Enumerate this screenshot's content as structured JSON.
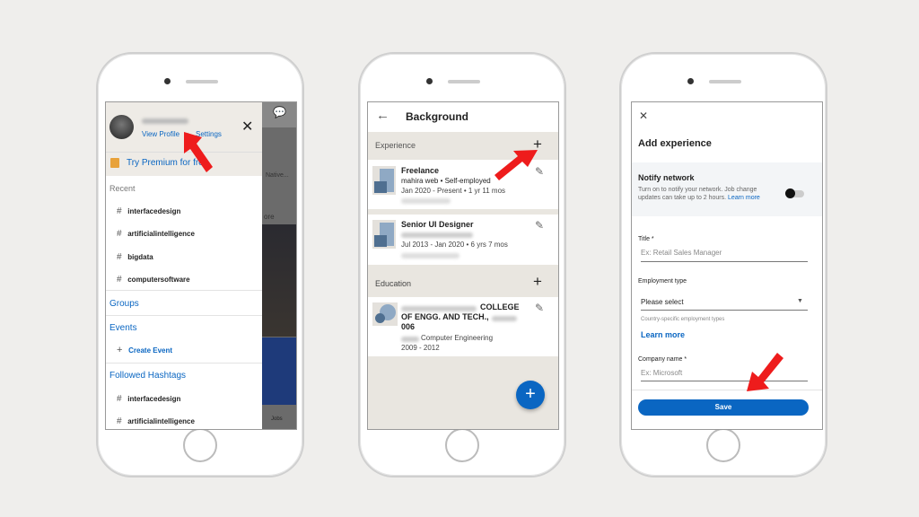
{
  "phone1": {
    "links": {
      "view_profile": "View Profile",
      "separator": "•",
      "settings": "Settings"
    },
    "premium": "Try Premium for free",
    "recent_label": "Recent",
    "recent": [
      "interfacedesign",
      "artificialintelligence",
      "bigdata",
      "computersoftware"
    ],
    "groups": "Groups",
    "events": "Events",
    "create_event": "Create Event",
    "followed_label": "Followed Hashtags",
    "followed": [
      "interfacedesign",
      "artificialintelligence"
    ],
    "background_feed": {
      "snippet": "Native...",
      "more": "ore",
      "jobs": "Jobs"
    }
  },
  "phone2": {
    "title": "Background",
    "experience_label": "Experience",
    "experience": [
      {
        "title": "Freelance",
        "company": "mahira web • Self-employed",
        "dates": "Jan 2020 - Present • 1 yr 11 mos"
      },
      {
        "title": "Senior UI Designer",
        "dates": "Jul 2013 - Jan 2020 • 6 yrs 7 mos"
      }
    ],
    "education_label": "Education",
    "education": {
      "name1": "COLLEGE",
      "name2": "OF ENGG. AND TECH.,",
      "name3": "006",
      "degree": "Computer Engineering",
      "years": "2009 - 2012"
    }
  },
  "phone3": {
    "title": "Add experience",
    "notify_title": "Notify network",
    "notify_desc1": "Turn on to notify your network. Job change",
    "notify_desc2": "updates can take up to 2 hours.",
    "notify_link": "Learn more",
    "notify_on": false,
    "title_label": "Title *",
    "title_placeholder": "Ex: Retail Sales Manager",
    "employment_label": "Employment type",
    "employment_value": "Please select",
    "employment_hint": "Country-specific employment types",
    "learn_more": "Learn more",
    "company_label": "Company name *",
    "company_placeholder": "Ex: Microsoft",
    "save": "Save"
  },
  "colors": {
    "accent": "#0a66c2",
    "arrow": "#ee1c1c",
    "band": "#e9e6e0"
  }
}
